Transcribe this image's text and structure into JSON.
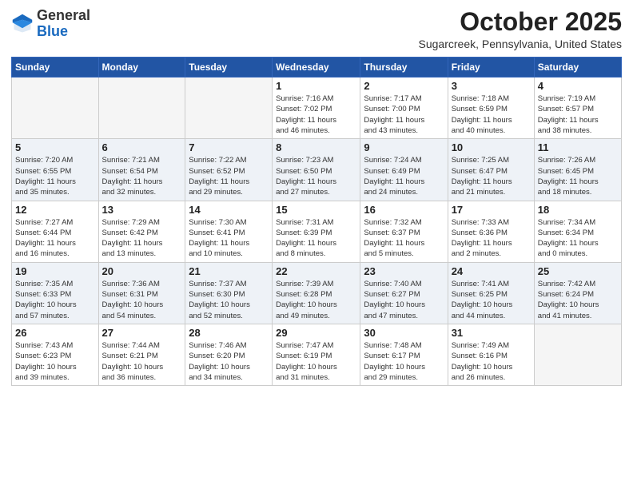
{
  "logo": {
    "general": "General",
    "blue": "Blue"
  },
  "header": {
    "month": "October 2025",
    "location": "Sugarcreek, Pennsylvania, United States"
  },
  "days_of_week": [
    "Sunday",
    "Monday",
    "Tuesday",
    "Wednesday",
    "Thursday",
    "Friday",
    "Saturday"
  ],
  "weeks": [
    [
      {
        "day": "",
        "info": ""
      },
      {
        "day": "",
        "info": ""
      },
      {
        "day": "",
        "info": ""
      },
      {
        "day": "1",
        "info": "Sunrise: 7:16 AM\nSunset: 7:02 PM\nDaylight: 11 hours\nand 46 minutes."
      },
      {
        "day": "2",
        "info": "Sunrise: 7:17 AM\nSunset: 7:00 PM\nDaylight: 11 hours\nand 43 minutes."
      },
      {
        "day": "3",
        "info": "Sunrise: 7:18 AM\nSunset: 6:59 PM\nDaylight: 11 hours\nand 40 minutes."
      },
      {
        "day": "4",
        "info": "Sunrise: 7:19 AM\nSunset: 6:57 PM\nDaylight: 11 hours\nand 38 minutes."
      }
    ],
    [
      {
        "day": "5",
        "info": "Sunrise: 7:20 AM\nSunset: 6:55 PM\nDaylight: 11 hours\nand 35 minutes."
      },
      {
        "day": "6",
        "info": "Sunrise: 7:21 AM\nSunset: 6:54 PM\nDaylight: 11 hours\nand 32 minutes."
      },
      {
        "day": "7",
        "info": "Sunrise: 7:22 AM\nSunset: 6:52 PM\nDaylight: 11 hours\nand 29 minutes."
      },
      {
        "day": "8",
        "info": "Sunrise: 7:23 AM\nSunset: 6:50 PM\nDaylight: 11 hours\nand 27 minutes."
      },
      {
        "day": "9",
        "info": "Sunrise: 7:24 AM\nSunset: 6:49 PM\nDaylight: 11 hours\nand 24 minutes."
      },
      {
        "day": "10",
        "info": "Sunrise: 7:25 AM\nSunset: 6:47 PM\nDaylight: 11 hours\nand 21 minutes."
      },
      {
        "day": "11",
        "info": "Sunrise: 7:26 AM\nSunset: 6:45 PM\nDaylight: 11 hours\nand 18 minutes."
      }
    ],
    [
      {
        "day": "12",
        "info": "Sunrise: 7:27 AM\nSunset: 6:44 PM\nDaylight: 11 hours\nand 16 minutes."
      },
      {
        "day": "13",
        "info": "Sunrise: 7:29 AM\nSunset: 6:42 PM\nDaylight: 11 hours\nand 13 minutes."
      },
      {
        "day": "14",
        "info": "Sunrise: 7:30 AM\nSunset: 6:41 PM\nDaylight: 11 hours\nand 10 minutes."
      },
      {
        "day": "15",
        "info": "Sunrise: 7:31 AM\nSunset: 6:39 PM\nDaylight: 11 hours\nand 8 minutes."
      },
      {
        "day": "16",
        "info": "Sunrise: 7:32 AM\nSunset: 6:37 PM\nDaylight: 11 hours\nand 5 minutes."
      },
      {
        "day": "17",
        "info": "Sunrise: 7:33 AM\nSunset: 6:36 PM\nDaylight: 11 hours\nand 2 minutes."
      },
      {
        "day": "18",
        "info": "Sunrise: 7:34 AM\nSunset: 6:34 PM\nDaylight: 11 hours\nand 0 minutes."
      }
    ],
    [
      {
        "day": "19",
        "info": "Sunrise: 7:35 AM\nSunset: 6:33 PM\nDaylight: 10 hours\nand 57 minutes."
      },
      {
        "day": "20",
        "info": "Sunrise: 7:36 AM\nSunset: 6:31 PM\nDaylight: 10 hours\nand 54 minutes."
      },
      {
        "day": "21",
        "info": "Sunrise: 7:37 AM\nSunset: 6:30 PM\nDaylight: 10 hours\nand 52 minutes."
      },
      {
        "day": "22",
        "info": "Sunrise: 7:39 AM\nSunset: 6:28 PM\nDaylight: 10 hours\nand 49 minutes."
      },
      {
        "day": "23",
        "info": "Sunrise: 7:40 AM\nSunset: 6:27 PM\nDaylight: 10 hours\nand 47 minutes."
      },
      {
        "day": "24",
        "info": "Sunrise: 7:41 AM\nSunset: 6:25 PM\nDaylight: 10 hours\nand 44 minutes."
      },
      {
        "day": "25",
        "info": "Sunrise: 7:42 AM\nSunset: 6:24 PM\nDaylight: 10 hours\nand 41 minutes."
      }
    ],
    [
      {
        "day": "26",
        "info": "Sunrise: 7:43 AM\nSunset: 6:23 PM\nDaylight: 10 hours\nand 39 minutes."
      },
      {
        "day": "27",
        "info": "Sunrise: 7:44 AM\nSunset: 6:21 PM\nDaylight: 10 hours\nand 36 minutes."
      },
      {
        "day": "28",
        "info": "Sunrise: 7:46 AM\nSunset: 6:20 PM\nDaylight: 10 hours\nand 34 minutes."
      },
      {
        "day": "29",
        "info": "Sunrise: 7:47 AM\nSunset: 6:19 PM\nDaylight: 10 hours\nand 31 minutes."
      },
      {
        "day": "30",
        "info": "Sunrise: 7:48 AM\nSunset: 6:17 PM\nDaylight: 10 hours\nand 29 minutes."
      },
      {
        "day": "31",
        "info": "Sunrise: 7:49 AM\nSunset: 6:16 PM\nDaylight: 10 hours\nand 26 minutes."
      },
      {
        "day": "",
        "info": ""
      }
    ]
  ]
}
